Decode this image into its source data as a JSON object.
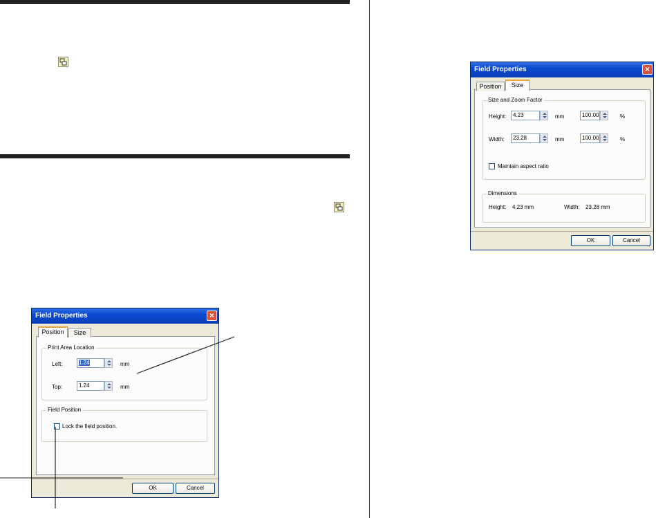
{
  "left_column": {
    "icons": [
      "field-properties-icon",
      "field-properties-icon"
    ]
  },
  "position_dialog": {
    "title": "Field Properties",
    "tabs": [
      "Position",
      "Size"
    ],
    "print_area_group": "Print Area Location",
    "left_label": "Left:",
    "left_value": "1.24",
    "left_unit": "mm",
    "top_label": "Top:",
    "top_value": "1.24",
    "top_unit": "mm",
    "field_position_group": "Field Position",
    "lock_label": "Lock the field position.",
    "ok": "OK",
    "cancel": "Cancel"
  },
  "size_dialog": {
    "title": "Field Properties",
    "tabs": [
      "Position",
      "Size"
    ],
    "size_zoom_group": "Size and Zoom Factor",
    "height_label": "Height:",
    "height_value": "4.23",
    "height_unit": "mm",
    "height_zoom": "100.00",
    "height_zoom_unit": "%",
    "width_label": "Width:",
    "width_value": "23.28",
    "width_unit": "mm",
    "width_zoom": "100.00",
    "width_zoom_unit": "%",
    "aspect_label": "Maintain aspect ratio",
    "dimensions_group": "Dimensions",
    "dim_height_label": "Height:",
    "dim_height_value": "4.23 mm",
    "dim_width_label": "Width:",
    "dim_width_value": "23.28 mm",
    "ok": "OK",
    "cancel": "Cancel"
  }
}
